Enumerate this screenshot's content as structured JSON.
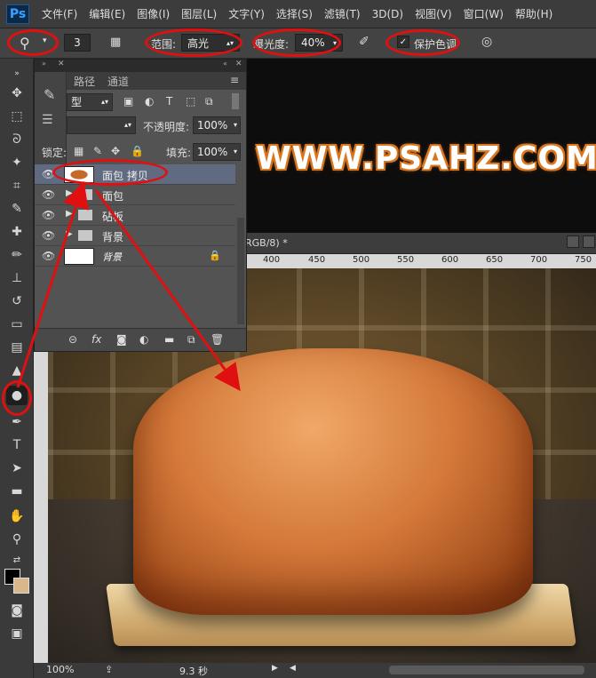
{
  "app": {
    "logo": "Ps"
  },
  "menu": {
    "items": [
      "文件(F)",
      "编辑(E)",
      "图像(I)",
      "图层(L)",
      "文字(Y)",
      "选择(S)",
      "滤镜(T)",
      "3D(D)",
      "视图(V)",
      "窗口(W)",
      "帮助(H)"
    ]
  },
  "options": {
    "brush_size": "3",
    "range_label": "范围:",
    "range_value": "高光",
    "exposure_label": "曝光度:",
    "exposure_value": "40%",
    "protect_label": "保护色调",
    "protect_checked": "✓"
  },
  "watermark": "WWW.PSAHZ.COM",
  "layers_panel": {
    "tabs": [
      "路径",
      "通道"
    ],
    "filter_label": "型",
    "opacity_label": "不透明度:",
    "opacity_value": "100%",
    "lock_label": "锁定:",
    "fill_label": "填充:",
    "fill_value": "100%",
    "layers": [
      {
        "name": "面包 拷贝",
        "selected": true
      },
      {
        "name": "面包"
      },
      {
        "name": "砧板"
      },
      {
        "name": "背景"
      },
      {
        "name": "背景"
      }
    ]
  },
  "document": {
    "tab_title": "RGB/8) *",
    "ruler_ticks": [
      "400",
      "450",
      "500",
      "550",
      "600",
      "650",
      "700",
      "750"
    ]
  },
  "status": {
    "zoom": "100%",
    "time": "9.3 秒"
  },
  "colors": {
    "annotation": "#e01010",
    "watermark_outline": "#d9761f"
  }
}
